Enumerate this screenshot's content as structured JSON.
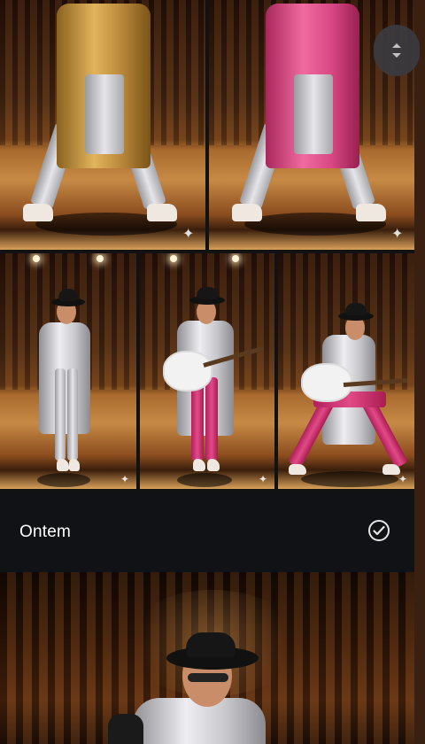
{
  "section": {
    "title": "Ontem"
  },
  "icons": {
    "select_all": "check-circle-icon",
    "scroll": "scroll-handle-icon",
    "sparkle": "sparkle-icon"
  },
  "colors": {
    "background": "#121212",
    "header_bg": "#111216",
    "text": "#ffffff"
  }
}
